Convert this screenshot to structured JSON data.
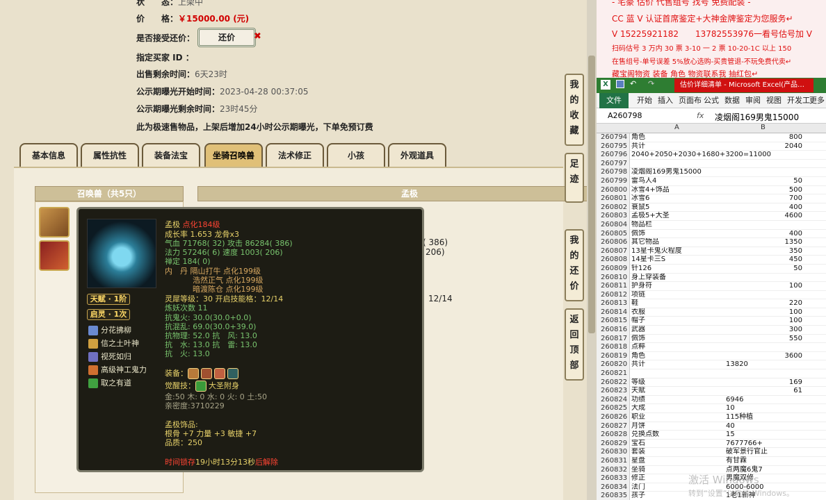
{
  "top": {
    "status_label": "状　　态：",
    "status_value": "上架中",
    "price_label": "价　　格：",
    "price_value": "￥15000.00 (元)",
    "counter_label": "是否接受还价：",
    "counter_button": "还价",
    "counter_x": "✖",
    "buyer_label": "指定买家 ID ：",
    "remain_label": "出售剩余时间：",
    "remain_value": "6天23时",
    "pub_start_label": "公示期曝光开始时间：",
    "pub_start_value": "2023-04-28 00:37:05",
    "pub_remain_label": "公示期曝光剩余时间：",
    "pub_remain_value": "23时45分",
    "fast_note": "此为极速售物品，上架后增加24小时公示期曝光，下单免预订费"
  },
  "tabs": [
    "基本信息",
    "属性抗性",
    "装备法宝",
    "坐骑召唤兽",
    "法术修正",
    "小孩",
    "外观道具"
  ],
  "pet_list_header": "召唤兽（共5只）",
  "detail_header": "孟极",
  "bg_values": {
    "v1": "( 386)",
    "v2": "206)",
    "v3": "12/14"
  },
  "tooltip": {
    "name": "孟极",
    "name_suffix": "点化184级",
    "growth": "成长率 1.653 龙骨x3",
    "hp": "气血 71768( 32) 攻击 86284( 386)",
    "mp": "法力 57246( 6) 速度 1003( 206)",
    "zen": "禅定 184( 0)",
    "neidan1": "内　丹 隔山打牛 点化199级",
    "neidan2": "浩然正气 点化199级",
    "neidan3": "暗渡陈仓 点化199级",
    "spirit": "灵犀等级：30 开启技能格：12/14",
    "refine": "炼妖次数 11",
    "res1": "抗鬼火: 30.0(30.0+0.0)",
    "res2": "抗混乱: 69.0(30.0+39.0)",
    "res3": "抗物理: 52.0 抗　风: 13.0",
    "res4": "抗　水: 13.0 抗　雷: 13.0",
    "res5": "抗　火: 13.0",
    "equip_label": "装备：",
    "awaken_label": "觉醒技：",
    "awaken_value": "大圣附身",
    "elements": "金:50 木: 0 水: 0 火: 0 土:50",
    "intimacy": "亲密度:3710229",
    "ornament_label": "孟极饰品:",
    "ornament_stats": "根骨 +7 力量 +3 敏捷 +7",
    "ornament_quality": "品质：250",
    "lock_prefix": "时间锁存",
    "lock_time": "19小时13分13秒",
    "lock_suffix": "后解除",
    "talent": "天赋 · 1阶",
    "spirit_badge": "启灵 · 1次",
    "skills": [
      "分花拂柳",
      "信之土叶神",
      "视死如归",
      "高级神工鬼力",
      "取之有道"
    ]
  },
  "side_buttons": [
    [
      "我",
      "的",
      "收",
      "藏"
    ],
    [
      "足",
      "迹"
    ],
    [
      "我",
      "的",
      "还",
      "价"
    ],
    [
      "返",
      "回",
      "顶",
      "部"
    ]
  ],
  "notice": {
    "line0": "‑ 宅豪  估价  代售组号  找号  免费配装 ‑",
    "line1": "CC 蓝 V 认证首席鉴定+大神金牌鉴定为您服务↵",
    "line2": "V 15225921182　　13782553976一看号估号加 V",
    "line3": "扫码估号 3 万内 30 票 3-10 一 2 票 10-20-1C 以上 150",
    "line4": "在售组号-单号误差 5%放心选购-买贵管退-不玩免费代卖↵",
    "line5": "藏宝阁物资 装备 角色 物资联系我 抽红包↵"
  },
  "excel": {
    "window_title": "估价详细清单 - Microsoft Excel(产品…",
    "ribbon_file": "文件",
    "ribbon_tabs": [
      "开始",
      "插入",
      "页面布",
      "公式",
      "数据",
      "审阅",
      "视图",
      "开发工",
      "更多"
    ],
    "name_box": "A260798",
    "fx": "fx",
    "formula": "凌烟阁169男鬼15000",
    "col_a": "A",
    "col_b": "B",
    "rows": [
      [
        "260794",
        "角色",
        "800"
      ],
      [
        "260795",
        "共计",
        "2040"
      ],
      [
        "260796",
        "2040+2050+2030+1680+3200=11000",
        ""
      ],
      [
        "260797",
        "",
        ""
      ],
      [
        "260798",
        "凌烟阁169男鬼15000",
        ""
      ],
      [
        "260799",
        "雷鸟人4",
        "50"
      ],
      [
        "260800",
        "冰雪4+饰品",
        "500"
      ],
      [
        "260801",
        "冰雪6",
        "700"
      ],
      [
        "260802",
        "衰鼠5",
        "400"
      ],
      [
        "260803",
        "孟极5+大圣",
        "4600"
      ],
      [
        "260804",
        "物品栏",
        ""
      ],
      [
        "260805",
        "佩饰",
        "400"
      ],
      [
        "260806",
        "其它物品",
        "1350"
      ],
      [
        "260807",
        "13星卡鬼火程度",
        "350"
      ],
      [
        "260808",
        "14星卡三S",
        "450"
      ],
      [
        "260809",
        "针126",
        "50"
      ],
      [
        "260810",
        "身上穿装备",
        ""
      ],
      [
        "260811",
        "护身符",
        "100"
      ],
      [
        "260812",
        "项链",
        ""
      ],
      [
        "260813",
        "鞋",
        "220"
      ],
      [
        "260814",
        "衣服",
        "100"
      ],
      [
        "260815",
        "帽子",
        "100"
      ],
      [
        "260816",
        "武器",
        "300"
      ],
      [
        "260817",
        "佩饰",
        "550"
      ],
      [
        "260818",
        "点粹",
        ""
      ],
      [
        "260819",
        "角色",
        "3600"
      ],
      [
        "260820",
        "共计",
        "13820"
      ],
      [
        "260821",
        "",
        ""
      ],
      [
        "260822",
        "等级",
        "169"
      ],
      [
        "260823",
        "天赋",
        "61"
      ],
      [
        "260824",
        "功绩",
        "6946"
      ],
      [
        "260825",
        "大成",
        "10"
      ],
      [
        "260826",
        "职业",
        "115种植"
      ],
      [
        "260827",
        "月饼",
        "40"
      ],
      [
        "260828",
        "兑换点数",
        "15"
      ],
      [
        "260829",
        "宝石",
        "7677766+"
      ],
      [
        "260830",
        "套装",
        "破军景行官止"
      ],
      [
        "260831",
        "星盘",
        "有甘霖"
      ],
      [
        "260832",
        "坐骑",
        "点两魔6鬼7"
      ],
      [
        "260833",
        "修正",
        "男魔双修"
      ],
      [
        "260834",
        "法门",
        "6000-6000"
      ],
      [
        "260835",
        "孩子",
        "1老1新神"
      ]
    ]
  },
  "watermark": "激活 Windows",
  "watermark_sub": "转到“设置”以激活 Windows。"
}
